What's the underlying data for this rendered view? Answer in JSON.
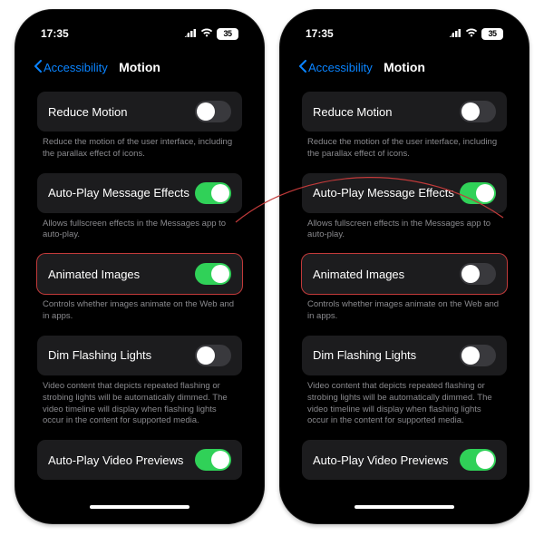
{
  "status": {
    "time": "17:35",
    "battery_text": "35"
  },
  "nav": {
    "back_label": "Accessibility",
    "title": "Motion"
  },
  "rows": {
    "reduce_motion": {
      "label": "Reduce Motion",
      "footer": "Reduce the motion of the user interface, including the parallax effect of icons."
    },
    "auto_play_msg": {
      "label": "Auto-Play Message Effects",
      "footer": "Allows fullscreen effects in the Messages app to auto-play."
    },
    "animated_images": {
      "label": "Animated Images",
      "footer": "Controls whether images animate on the Web and in apps."
    },
    "dim_flashing": {
      "label": "Dim Flashing Lights",
      "footer": "Video content that depicts repeated flashing or strobing lights will be automatically dimmed. The video timeline will display when flashing lights occur in the content for supported media."
    },
    "auto_play_video": {
      "label": "Auto-Play Video Previews"
    }
  },
  "states": {
    "left": {
      "reduce_motion": false,
      "auto_play_msg": true,
      "animated_images": true,
      "dim_flashing": false,
      "auto_play_video": true
    },
    "right": {
      "reduce_motion": false,
      "auto_play_msg": true,
      "animated_images": false,
      "dim_flashing": false,
      "auto_play_video": true
    }
  },
  "colors": {
    "accent_link": "#0a84ff",
    "toggle_on": "#30d158",
    "highlight": "#c23a3a"
  }
}
